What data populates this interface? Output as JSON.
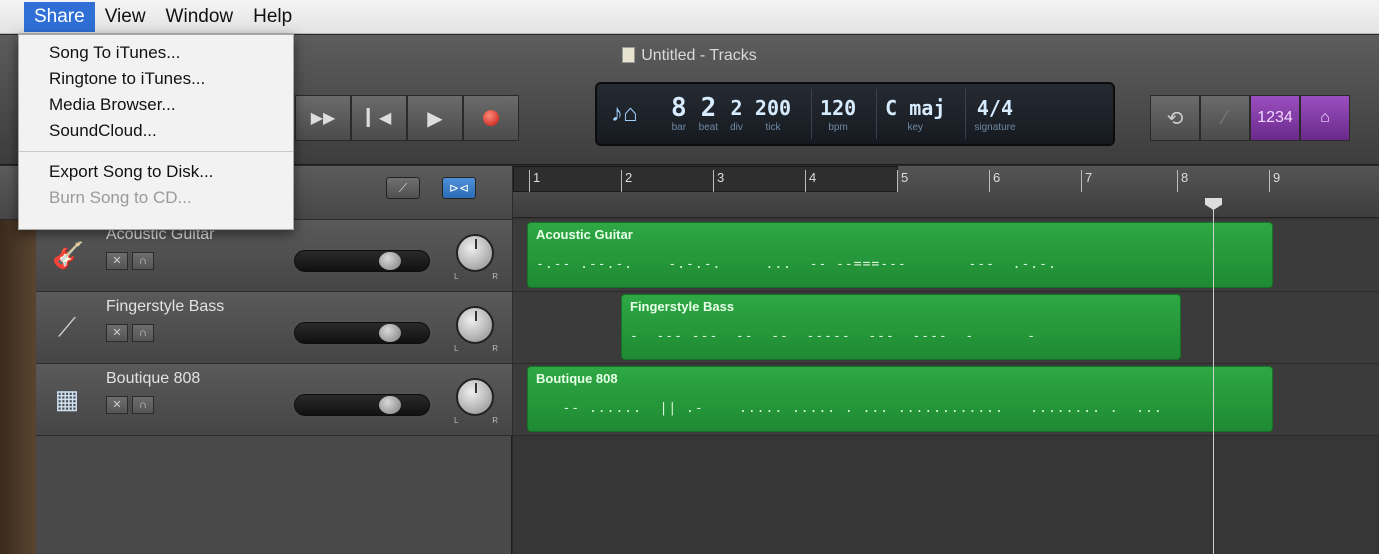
{
  "menubar": {
    "items": [
      "Share",
      "View",
      "Window",
      "Help"
    ]
  },
  "share_menu": {
    "items": [
      "Song To iTunes...",
      "Ringtone to iTunes...",
      "Media Browser...",
      "SoundCloud..."
    ],
    "export_items": [
      "Export Song to Disk...",
      "Burn Song to CD..."
    ]
  },
  "window": {
    "title": "Untitled - Tracks"
  },
  "lcd": {
    "bar": "8",
    "bar_label": "bar",
    "beat": "2",
    "beat_label": "beat",
    "div": "2",
    "div_label": "div",
    "tick": "200",
    "tick_label": "tick",
    "bpm": "120",
    "bpm_label": "bpm",
    "key": "C maj",
    "key_label": "key",
    "signature": "4/4",
    "signature_label": "signature"
  },
  "count_in": "1234",
  "ruler": {
    "bars": [
      "1",
      "2",
      "3",
      "4",
      "5",
      "6",
      "7",
      "8",
      "9"
    ]
  },
  "tracks": [
    {
      "name": "Acoustic Guitar",
      "icon": "guitar-icon",
      "region": "Acoustic Guitar"
    },
    {
      "name": "Fingerstyle Bass",
      "icon": "bass-icon",
      "region": "Fingerstyle Bass"
    },
    {
      "name": "Boutique 808",
      "icon": "drum-machine-icon",
      "region": "Boutique 808"
    }
  ],
  "colors": {
    "region_green": "#2ea844",
    "menu_highlight": "#2f6fd6",
    "count_in_purple": "#9b4fc0"
  }
}
